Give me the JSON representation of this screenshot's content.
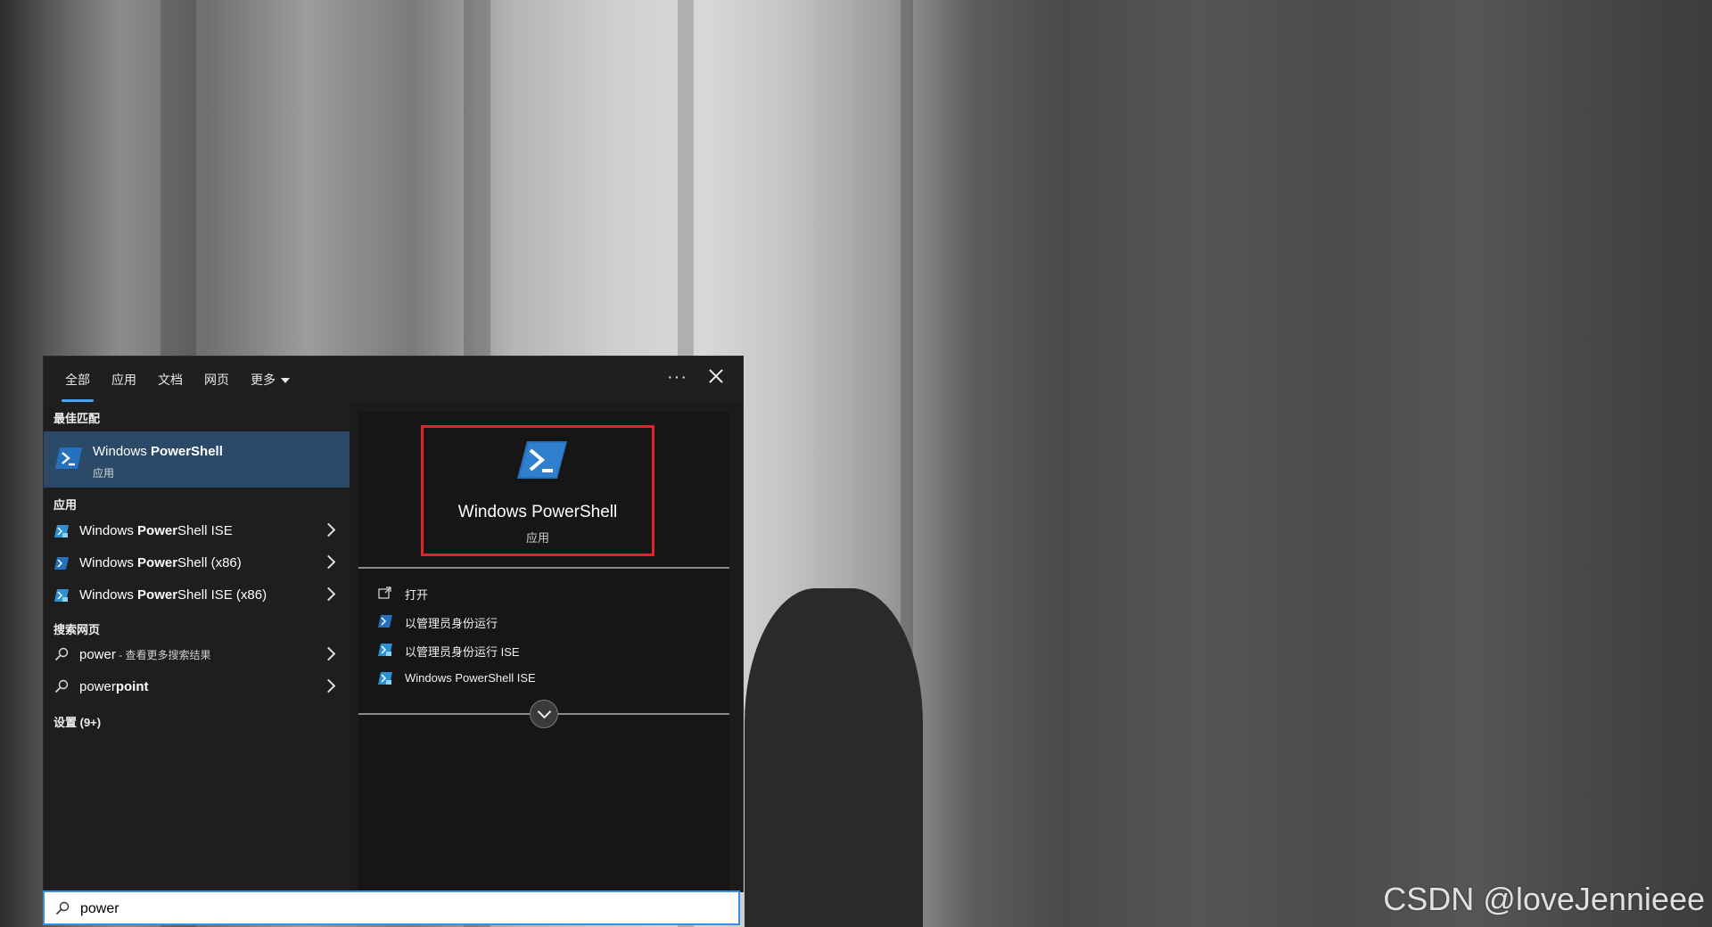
{
  "tabs": [
    {
      "label": "全部",
      "active": true
    },
    {
      "label": "应用"
    },
    {
      "label": "文档"
    },
    {
      "label": "网页"
    },
    {
      "label": "更多"
    }
  ],
  "more_options": "···",
  "sections": {
    "best_match": "最佳匹配",
    "apps": "应用",
    "web": "搜索网页",
    "settings": "设置 (9+)"
  },
  "best_match_item": {
    "title_prefix": "Windows ",
    "title_bold": "PowerShell",
    "subtitle": "应用",
    "icon": "powershell-icon"
  },
  "apps": [
    {
      "prefix": "Windows ",
      "bold": "Power",
      "suffix": "Shell ISE",
      "icon": "powershell-ise-icon"
    },
    {
      "prefix": "Windows ",
      "bold": "Power",
      "suffix": "Shell (x86)",
      "icon": "powershell-icon"
    },
    {
      "prefix": "Windows ",
      "bold": "Power",
      "suffix": "Shell ISE (x86)",
      "icon": "powershell-ise-icon"
    }
  ],
  "web_results": [
    {
      "label": "power",
      "sub": " - 查看更多搜索结果",
      "icon": "search-icon"
    },
    {
      "prefix": "power",
      "bold": "point",
      "icon": "search-icon"
    }
  ],
  "preview": {
    "title": "Windows PowerShell",
    "subtitle": "应用",
    "actions": [
      {
        "label": "打开",
        "icon": "open-icon"
      },
      {
        "label": "以管理员身份运行",
        "icon": "powershell-icon"
      },
      {
        "label": "以管理员身份运行 ISE",
        "icon": "powershell-ise-icon"
      },
      {
        "label": "Windows PowerShell ISE",
        "icon": "powershell-ise-icon"
      }
    ]
  },
  "search": {
    "value": "power"
  },
  "watermark": "CSDN @loveJennieee",
  "colors": {
    "accent": "#4aa3f5",
    "selected": "#2b4a67",
    "highlight_border": "#e0262b",
    "powershell_blue": "#2671be"
  }
}
